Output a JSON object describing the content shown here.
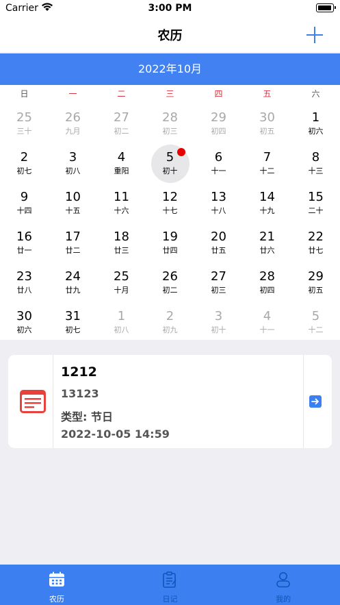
{
  "status": {
    "carrier": "Carrier",
    "time": "3:00 PM"
  },
  "nav": {
    "title": "农历"
  },
  "month_label": "2022年10月",
  "weekdays": [
    "日",
    "一",
    "二",
    "三",
    "四",
    "五",
    "六"
  ],
  "days": [
    {
      "d": "25",
      "l": "三十",
      "muted": true
    },
    {
      "d": "26",
      "l": "九月",
      "muted": true
    },
    {
      "d": "27",
      "l": "初二",
      "muted": true
    },
    {
      "d": "28",
      "l": "初三",
      "muted": true
    },
    {
      "d": "29",
      "l": "初四",
      "muted": true
    },
    {
      "d": "30",
      "l": "初五",
      "muted": true
    },
    {
      "d": "1",
      "l": "初六"
    },
    {
      "d": "2",
      "l": "初七"
    },
    {
      "d": "3",
      "l": "初八"
    },
    {
      "d": "4",
      "l": "重阳"
    },
    {
      "d": "5",
      "l": "初十",
      "selected": true,
      "has_event": true
    },
    {
      "d": "6",
      "l": "十一"
    },
    {
      "d": "7",
      "l": "十二"
    },
    {
      "d": "8",
      "l": "十三"
    },
    {
      "d": "9",
      "l": "十四"
    },
    {
      "d": "10",
      "l": "十五"
    },
    {
      "d": "11",
      "l": "十六"
    },
    {
      "d": "12",
      "l": "十七"
    },
    {
      "d": "13",
      "l": "十八"
    },
    {
      "d": "14",
      "l": "十九"
    },
    {
      "d": "15",
      "l": "二十"
    },
    {
      "d": "16",
      "l": "廿一"
    },
    {
      "d": "17",
      "l": "廿二"
    },
    {
      "d": "18",
      "l": "廿三"
    },
    {
      "d": "19",
      "l": "廿四"
    },
    {
      "d": "20",
      "l": "廿五"
    },
    {
      "d": "21",
      "l": "廿六"
    },
    {
      "d": "22",
      "l": "廿七"
    },
    {
      "d": "23",
      "l": "廿八"
    },
    {
      "d": "24",
      "l": "廿九"
    },
    {
      "d": "25",
      "l": "十月"
    },
    {
      "d": "26",
      "l": "初二"
    },
    {
      "d": "27",
      "l": "初三"
    },
    {
      "d": "28",
      "l": "初四"
    },
    {
      "d": "29",
      "l": "初五"
    },
    {
      "d": "30",
      "l": "初六"
    },
    {
      "d": "31",
      "l": "初七"
    },
    {
      "d": "1",
      "l": "初八",
      "muted": true
    },
    {
      "d": "2",
      "l": "初九",
      "muted": true
    },
    {
      "d": "3",
      "l": "初十",
      "muted": true
    },
    {
      "d": "4",
      "l": "十一",
      "muted": true
    },
    {
      "d": "5",
      "l": "十二",
      "muted": true
    }
  ],
  "event": {
    "title": "1212",
    "content": "13123",
    "type": "类型: 节日",
    "datetime": "2022-10-05 14:59"
  },
  "tabs": [
    {
      "label": "农历",
      "icon": "calendar-icon",
      "active": true
    },
    {
      "label": "日记",
      "icon": "notes-icon",
      "active": false
    },
    {
      "label": "我的",
      "icon": "user-icon",
      "active": false
    }
  ],
  "colors": {
    "accent": "#3b7ff0",
    "month_bar": "#4181f1",
    "weekday_red": "#d9333a",
    "event_dot": "#e80000",
    "doc_icon_red": "#e8403a"
  }
}
